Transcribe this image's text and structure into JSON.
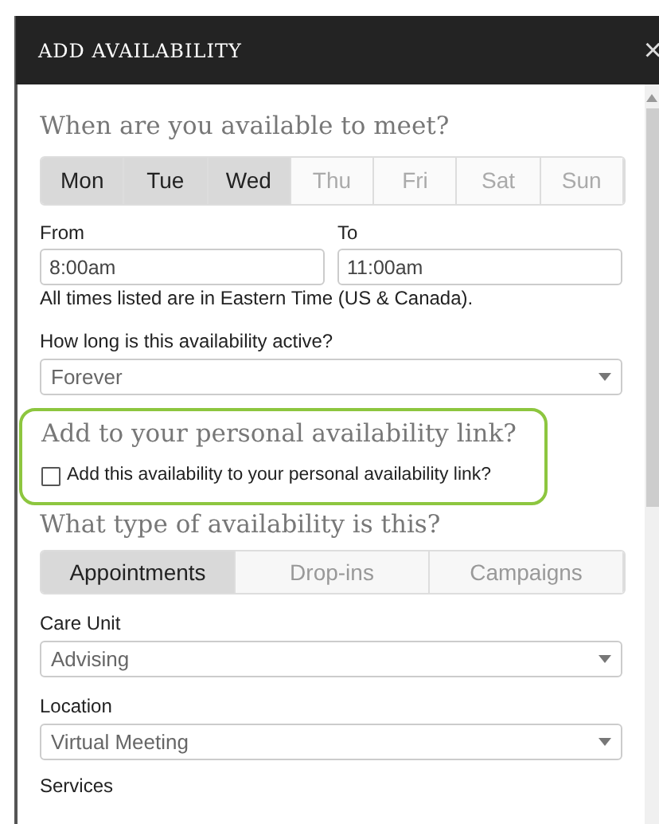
{
  "window": {
    "title": "ADD AVAILABILITY",
    "close": "×"
  },
  "when": {
    "heading": "When are you available to meet?",
    "days": [
      {
        "label": "Mon",
        "selected": true
      },
      {
        "label": "Tue",
        "selected": true
      },
      {
        "label": "Wed",
        "selected": true
      },
      {
        "label": "Thu",
        "selected": false
      },
      {
        "label": "Fri",
        "selected": false
      },
      {
        "label": "Sat",
        "selected": false
      },
      {
        "label": "Sun",
        "selected": false
      }
    ]
  },
  "from": {
    "label": "From",
    "value": "8:00am"
  },
  "to": {
    "label": "To",
    "value": "11:00am"
  },
  "timezone_note": "All times listed are in Eastern Time (US & Canada).",
  "duration": {
    "label": "How long is this availability active?",
    "value": "Forever"
  },
  "personal_link": {
    "heading": "Add to your personal availability link?",
    "checkbox_label": "Add this availability to your personal availability link?",
    "checked": false
  },
  "type": {
    "heading": "What type of availability is this?",
    "tabs": [
      {
        "label": "Appointments",
        "selected": true
      },
      {
        "label": "Drop-ins",
        "selected": false
      },
      {
        "label": "Campaigns",
        "selected": false
      }
    ]
  },
  "care_unit": {
    "label": "Care Unit",
    "value": "Advising"
  },
  "location": {
    "label": "Location",
    "value": "Virtual Meeting"
  },
  "services": {
    "label": "Services"
  }
}
